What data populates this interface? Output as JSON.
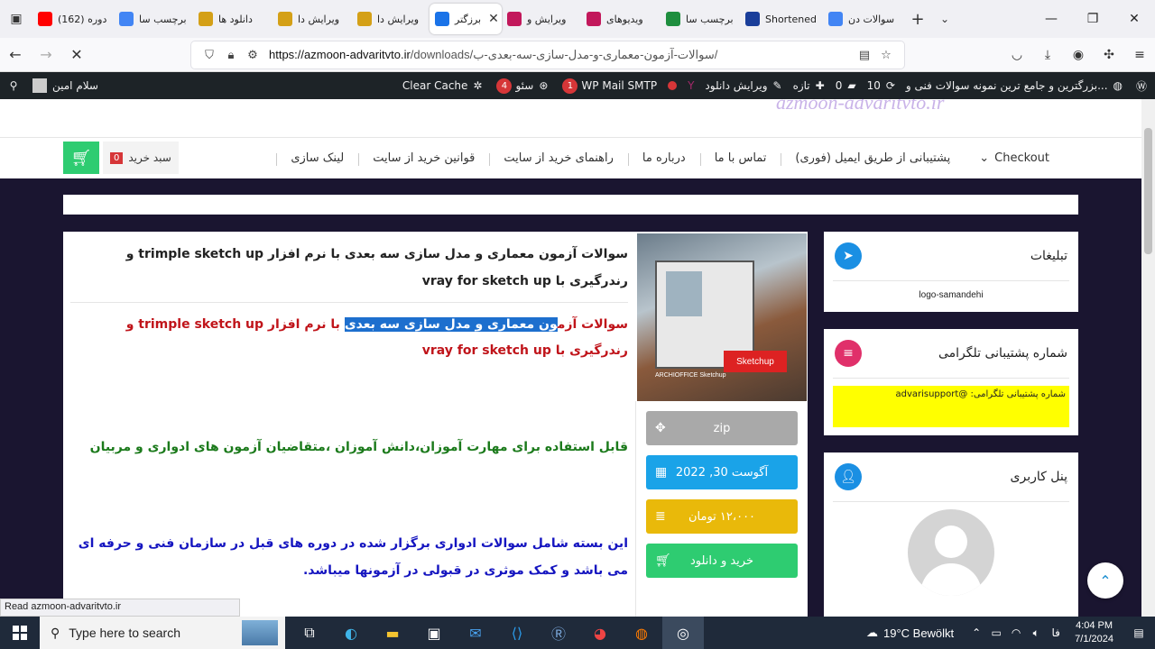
{
  "browser": {
    "tabs": [
      {
        "label": "(162) دوره",
        "icon_color": "#ff0000",
        "icon": "youtube-icon"
      },
      {
        "label": "برچسب سا",
        "icon_color": "#4285f4",
        "icon": "google-icon"
      },
      {
        "label": "دانلود ها",
        "icon_color": "#d4a017",
        "icon": "site-icon"
      },
      {
        "label": "ویرایش دا",
        "icon_color": "#d4a017",
        "icon": "site-icon"
      },
      {
        "label": "ویرایش دا",
        "icon_color": "#d4a017",
        "icon": "site-icon"
      },
      {
        "label": "برزگتر",
        "icon_color": "#1a73e8",
        "icon": "loading-icon",
        "active": true
      },
      {
        "label": "ویرایش و",
        "icon_color": "#c2185b",
        "icon": "site-icon"
      },
      {
        "label": "ویدیوهای",
        "icon_color": "#c2185b",
        "icon": "site-icon"
      },
      {
        "label": "برچسب سا",
        "icon_color": "#1e8e3e",
        "icon": "check-icon"
      },
      {
        "label": "Shortened",
        "icon_color": "#1a3e9a",
        "icon": "link-icon"
      },
      {
        "label": "سوالات دن",
        "icon_color": "#4285f4",
        "icon": "google-icon"
      }
    ],
    "url_host": "https://azmoon-advaritvto.ir",
    "url_path": "/downloads/سوالات-آزمون-معماری-و-مدل-سازی-سه-بعدی-ب/"
  },
  "adminbar": {
    "greeting": "سلام امین",
    "clear_cache": "Clear Cache",
    "seo_label": "سئو",
    "seo_count": "4",
    "smtp_label": "WP Mail SMTP",
    "smtp_count": "1",
    "edit_download": "ویرایش دانلود",
    "new_label": "تازه",
    "comments_count": "0",
    "updates_count": "10",
    "site_name": "بزرگترین و جامع ترین نمونه سوالات فنی و..."
  },
  "menu": {
    "items": [
      "Checkout",
      "پشتیبانی از طریق ایمیل (فوری)",
      "تماس با ما",
      "درباره ما",
      "راهنمای خرید از سایت",
      "قوانین خرید از سایت",
      "لینک سازی"
    ],
    "cart_label": "سبد خرید",
    "cart_count": "0"
  },
  "product": {
    "title": "سوالات آزمون معماری و مدل سازی سه بعدی با نرم افزار trimple sketch up و رندرگیری با vray for sketch up",
    "red_title_pre": "سوالات آزم",
    "red_title_hl": "ون معماری و مدل سازی سه بعدی",
    "red_title_post": " با نرم افزار trimple sketch up و رندرگیری با vray for sketch up",
    "green_text": "قابل استفاده برای مهارت آموزان،دانش آموزان ،متقاضیان آزمون های ادواری و مربیان",
    "blue_text": "این بسته شامل سوالات ادواری برگزار شده در دوره های قبل در سازمان فنی و حرفه ای می باشد و کمک موثری در قبولی در آزمونها میباشد.",
    "image_brand": "Sketchup",
    "image_caption": "ARCHIOFFICE Sketchup",
    "file_type": "zip",
    "date": "آگوست 30, 2022",
    "price": "۱۲،۰۰۰ تومان",
    "buy_label": "خرید و دانلود"
  },
  "sidebar": {
    "ads_title": "تبلیغات",
    "ads_logo": "logo-samandehi",
    "telegram_title": "شماره پشتیبانی تلگرامی",
    "telegram_text": "شماره پشتیبانی تلگرامی: @advarisupport",
    "user_panel_title": "پنل کاربری"
  },
  "statusbar": "Read azmoon-advaritvto.ir",
  "taskbar": {
    "search_placeholder": "Type here to search",
    "weather": "19°C  Bewölkt",
    "weather_badge": "1",
    "lang": "فا",
    "time": "4:04 PM",
    "date": "7/1/2024",
    "notif_count": "10"
  }
}
